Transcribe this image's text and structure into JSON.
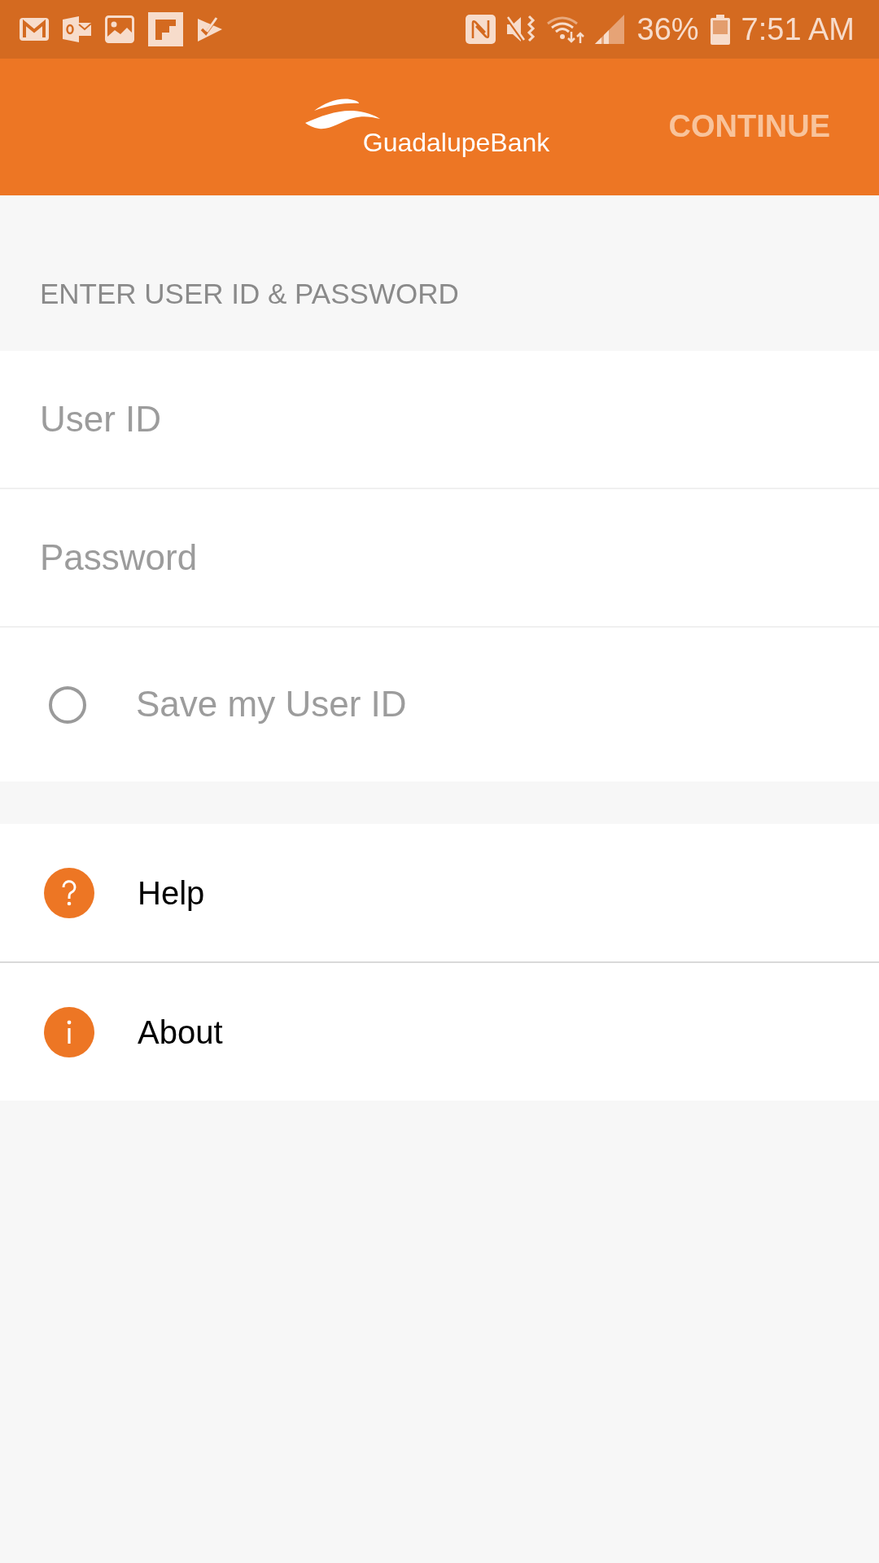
{
  "status_bar": {
    "battery": "36%",
    "time": "7:51 AM"
  },
  "header": {
    "brand": "GuadalupeBank",
    "action": {
      "label": "CONTINUE",
      "disabled": true
    }
  },
  "login": {
    "section_title": "ENTER USER ID & PASSWORD",
    "fields": [
      {
        "placeholder": "User ID"
      },
      {
        "placeholder": "Password"
      }
    ],
    "save_user_id": {
      "label": "Save my User ID",
      "checked": false
    }
  },
  "menu": [
    {
      "label": "Help",
      "kind": "help"
    },
    {
      "label": "About",
      "kind": "info"
    }
  ]
}
